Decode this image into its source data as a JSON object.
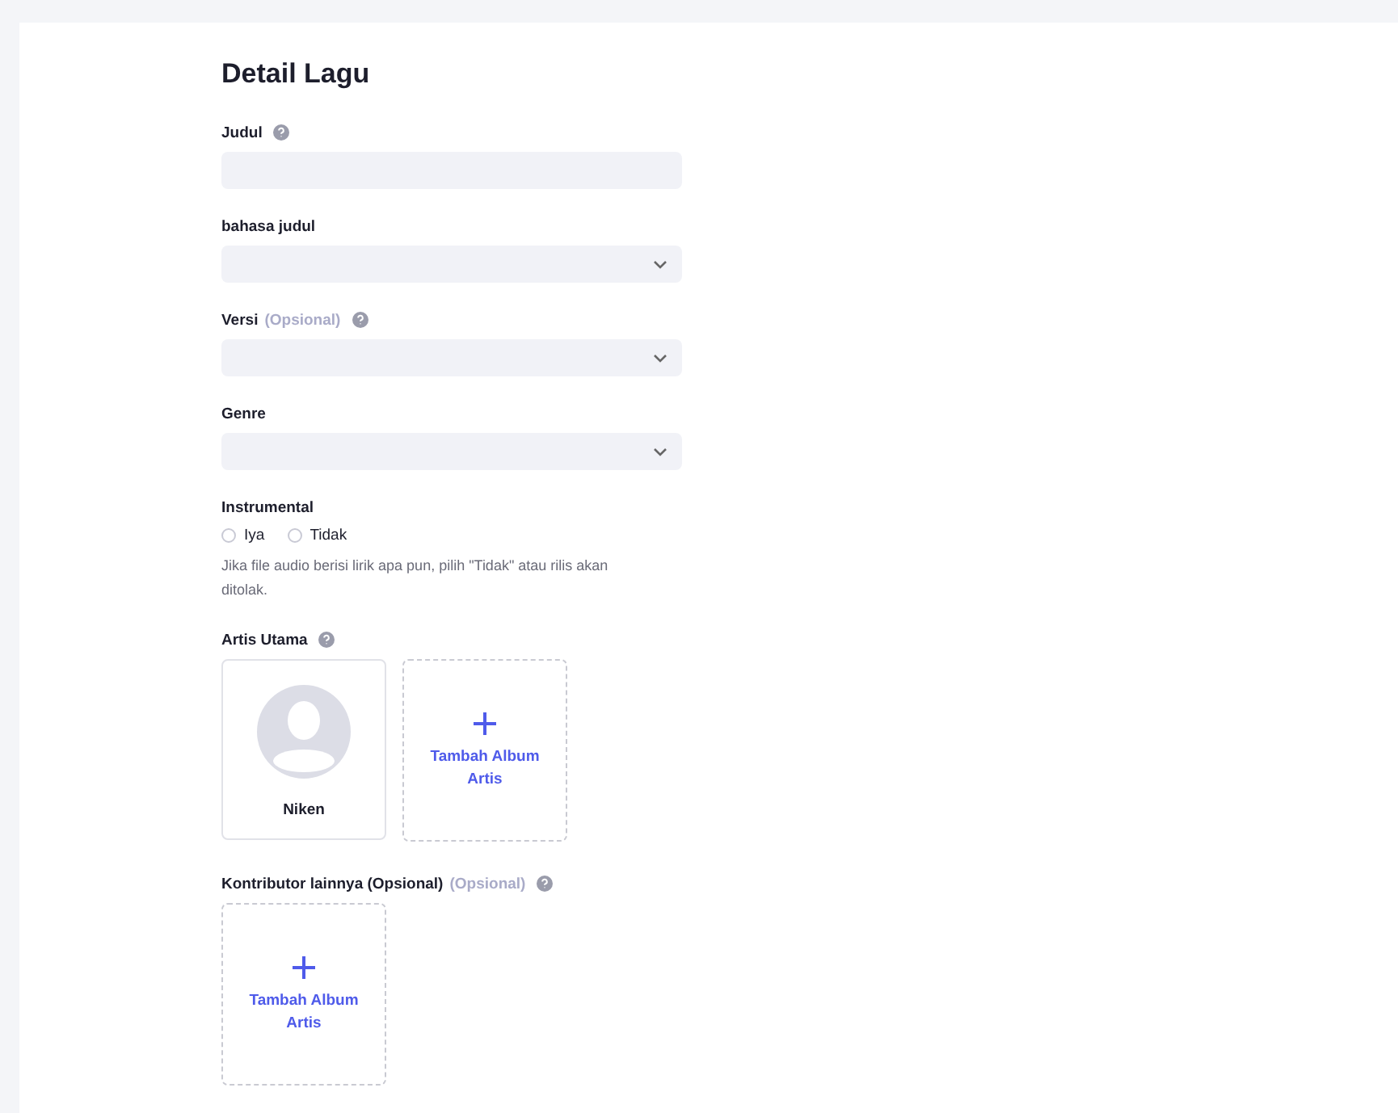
{
  "title": "Detail Lagu",
  "fields": [
    {
      "label": "Judul",
      "help": true,
      "kind": "text"
    },
    {
      "label": "bahasa judul",
      "kind": "select"
    },
    {
      "label": "Versi",
      "optional": "(Opsional)",
      "help": true,
      "kind": "select"
    },
    {
      "label": "Genre",
      "kind": "select"
    }
  ],
  "instrumental": {
    "label": "Instrumental",
    "options": [
      {
        "label": "Iya",
        "selected": false
      },
      {
        "label": "Tidak",
        "selected": false
      }
    ],
    "hint": "Jika file audio berisi lirik apa pun, pilih \"Tidak\" atau rilis akan ditolak."
  },
  "sections": [
    {
      "label": "Artis Utama",
      "help": true,
      "cards": [
        {
          "kind": "artist",
          "name": "Niken"
        },
        {
          "kind": "add",
          "label": "Tambah Album Artis"
        }
      ]
    },
    {
      "label": "Kontributor lainnya (Opsional)",
      "optional": "(Opsional)",
      "help": true,
      "cards": [
        {
          "kind": "add",
          "label": "Tambah Album Artis"
        }
      ]
    }
  ]
}
